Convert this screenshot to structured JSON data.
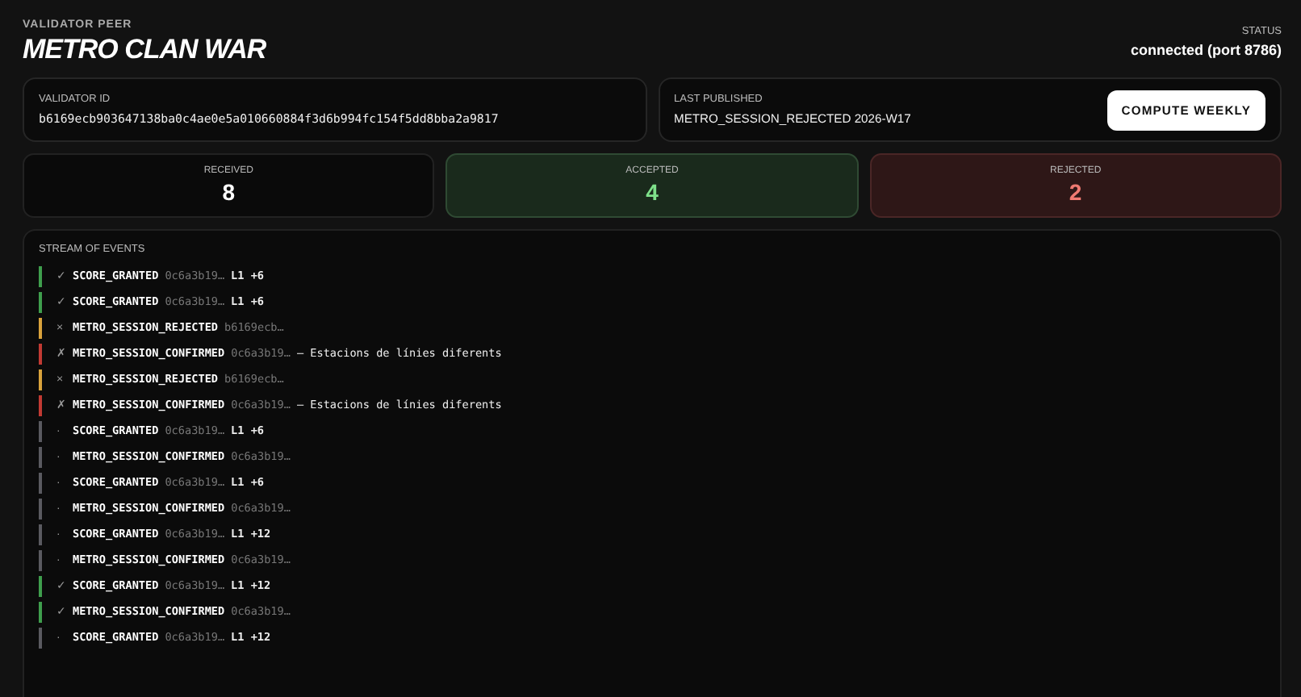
{
  "header": {
    "eyebrow": "VALIDATOR PEER",
    "title": "METRO CLAN WAR",
    "status_label": "STATUS",
    "status_value": "connected (port 8786)"
  },
  "validator": {
    "label": "VALIDATOR ID",
    "value": "b6169ecb903647138ba0c4ae0e5a010660884f3d6b994fc154f5dd8bba2a9817"
  },
  "published": {
    "label": "LAST PUBLISHED",
    "value": "METRO_SESSION_REJECTED 2026-W17",
    "button": "COMPUTE WEEKLY"
  },
  "stats": [
    {
      "kind": "neutral",
      "label": "RECEIVED",
      "value": "8"
    },
    {
      "kind": "accepted",
      "label": "ACCEPTED",
      "value": "4"
    },
    {
      "kind": "rejected",
      "label": "REJECTED",
      "value": "2"
    }
  ],
  "stream": {
    "title": "STREAM OF EVENTS",
    "events": [
      {
        "kind": "accepted",
        "mark": "✓",
        "type": "SCORE_GRANTED",
        "id": "0c6a3b19…",
        "detail": "L1 +6"
      },
      {
        "kind": "accepted",
        "mark": "✓",
        "type": "SCORE_GRANTED",
        "id": "0c6a3b19…",
        "detail": "L1 +6"
      },
      {
        "kind": "rejected",
        "mark": "×",
        "type": "METRO_SESSION_REJECTED",
        "id": "b6169ecb…"
      },
      {
        "kind": "error",
        "mark": "✗",
        "type": "METRO_SESSION_CONFIRMED",
        "id": "0c6a3b19…",
        "detail": "— Estacions de línies diferents"
      },
      {
        "kind": "rejected",
        "mark": "×",
        "type": "METRO_SESSION_REJECTED",
        "id": "b6169ecb…"
      },
      {
        "kind": "error",
        "mark": "✗",
        "type": "METRO_SESSION_CONFIRMED",
        "id": "0c6a3b19…",
        "detail": "— Estacions de línies diferents"
      },
      {
        "kind": "pending",
        "mark": "·",
        "type": "SCORE_GRANTED",
        "id": "0c6a3b19…",
        "detail": "L1 +6"
      },
      {
        "kind": "pending",
        "mark": "·",
        "type": "METRO_SESSION_CONFIRMED",
        "id": "0c6a3b19…"
      },
      {
        "kind": "pending",
        "mark": "·",
        "type": "SCORE_GRANTED",
        "id": "0c6a3b19…",
        "detail": "L1 +6"
      },
      {
        "kind": "pending",
        "mark": "·",
        "type": "METRO_SESSION_CONFIRMED",
        "id": "0c6a3b19…"
      },
      {
        "kind": "pending",
        "mark": "·",
        "type": "SCORE_GRANTED",
        "id": "0c6a3b19…",
        "detail": "L1 +12"
      },
      {
        "kind": "pending",
        "mark": "·",
        "type": "METRO_SESSION_CONFIRMED",
        "id": "0c6a3b19…"
      },
      {
        "kind": "accepted",
        "mark": "✓",
        "type": "SCORE_GRANTED",
        "id": "0c6a3b19…",
        "detail": "L1 +12"
      },
      {
        "kind": "accepted",
        "mark": "✓",
        "type": "METRO_SESSION_CONFIRMED",
        "id": "0c6a3b19…"
      },
      {
        "kind": "pending",
        "mark": "·",
        "type": "SCORE_GRANTED",
        "id": "0c6a3b19…",
        "detail": "L1 +12"
      }
    ]
  }
}
